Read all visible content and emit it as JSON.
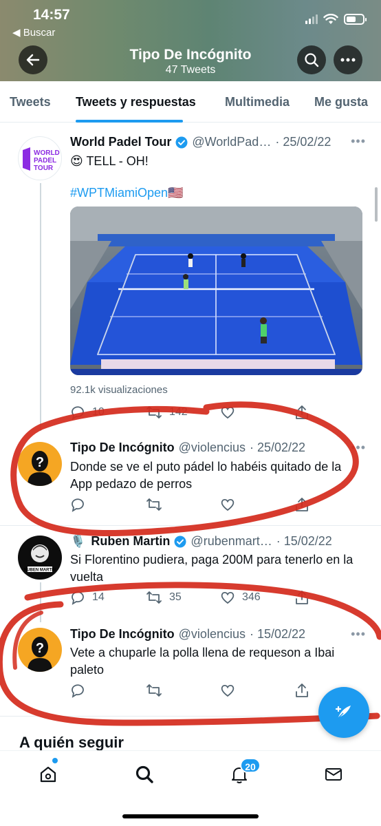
{
  "status_bar": {
    "time": "14:57",
    "back_app": "◀ Buscar"
  },
  "header": {
    "title": "Tipo De Incógnito",
    "subtitle": "47 Tweets"
  },
  "tabs": [
    {
      "label": "Tweets"
    },
    {
      "label": "Tweets y respuestas"
    },
    {
      "label": "Multimedia"
    },
    {
      "label": "Me gusta"
    }
  ],
  "tweets": [
    {
      "name": "World Padel Tour",
      "handle": "@WorldPad…",
      "date": "· 25/02/22",
      "text": "😍 TELL - OH!",
      "hashtag": "#WPTMiamiOpen🇺🇸",
      "avatar_logo": "WORLD PADEL TOUR",
      "views": "92.1k visualizaciones",
      "replies": "10",
      "retweets": "142",
      "likes": ""
    },
    {
      "name": "Tipo De Incógnito",
      "handle": "@violencius",
      "date": "· 25/02/22",
      "text": "Donde se ve el puto pádel lo habéis quitado de la App pedazo de perros"
    },
    {
      "name": "Ruben Martin",
      "handle": "@rubenmart…",
      "date": "· 15/02/22",
      "text": "Si Florentino pudiera, paga 200M para tenerlo en la vuelta",
      "avatar_label": "RUBEN MARTIN",
      "replies": "14",
      "retweets": "35",
      "likes": "346"
    },
    {
      "name": "Tipo De Incógnito",
      "handle": "@violencius",
      "date": "· 15/02/22",
      "text": "Vete a chuparle la polla llena de requeson a Ibai paleto"
    }
  ],
  "section": {
    "who_to_follow": "A quién seguir"
  },
  "nav": {
    "notifications_badge": "20"
  },
  "colors": {
    "accent": "#1d9bf0",
    "annotation": "#d42a1c"
  }
}
